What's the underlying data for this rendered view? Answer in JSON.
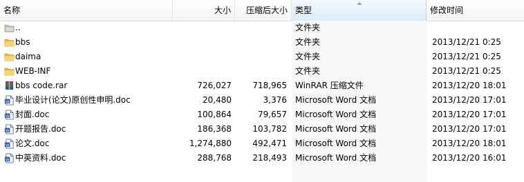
{
  "columns": {
    "name": "名称",
    "size": "大小",
    "packed": "压缩后大小",
    "type": "类型",
    "modified": "修改时间"
  },
  "files": [
    {
      "icon": "parent-folder-icon",
      "name": "..",
      "size": "",
      "packed": "",
      "type": "文件夹",
      "modified": ""
    },
    {
      "icon": "folder-icon",
      "name": "bbs",
      "size": "",
      "packed": "",
      "type": "文件夹",
      "modified": "2013/12/21 0:25"
    },
    {
      "icon": "folder-icon",
      "name": "daima",
      "size": "",
      "packed": "",
      "type": "文件夹",
      "modified": "2013/12/21 0:25"
    },
    {
      "icon": "folder-icon",
      "name": "WEB-INF",
      "size": "",
      "packed": "",
      "type": "文件夹",
      "modified": "2013/12/21 0:25"
    },
    {
      "icon": "rar-archive-icon",
      "name": "bbs code.rar",
      "size": "726,027",
      "packed": "718,965",
      "type": "WinRAR 压缩文件",
      "modified": "2013/12/20 18:01"
    },
    {
      "icon": "word-document-icon",
      "name": "毕业设计(论文)原创性申明.doc",
      "size": "20,480",
      "packed": "3,376",
      "type": "Microsoft Word 文档",
      "modified": "2013/12/20 17:01"
    },
    {
      "icon": "word-document-icon",
      "name": "封面.doc",
      "size": "100,864",
      "packed": "79,657",
      "type": "Microsoft Word 文档",
      "modified": "2013/12/20 17:01"
    },
    {
      "icon": "word-document-icon",
      "name": "开题报告.doc",
      "size": "186,368",
      "packed": "103,782",
      "type": "Microsoft Word 文档",
      "modified": "2013/12/20 17:01"
    },
    {
      "icon": "word-document-icon",
      "name": "论文.doc",
      "size": "1,274,880",
      "packed": "492,471",
      "type": "Microsoft Word 文档",
      "modified": "2013/12/20 18:01"
    },
    {
      "icon": "word-document-icon",
      "name": "中英资料.doc",
      "size": "288,768",
      "packed": "218,493",
      "type": "Microsoft Word 文档",
      "modified": "2013/12/20 16:01"
    }
  ],
  "colors": {
    "sorted_header": "#dcecfa",
    "type_column_bg": "#f7f7f7",
    "folder": "#f2c94c",
    "word_blue": "#2b5797"
  }
}
